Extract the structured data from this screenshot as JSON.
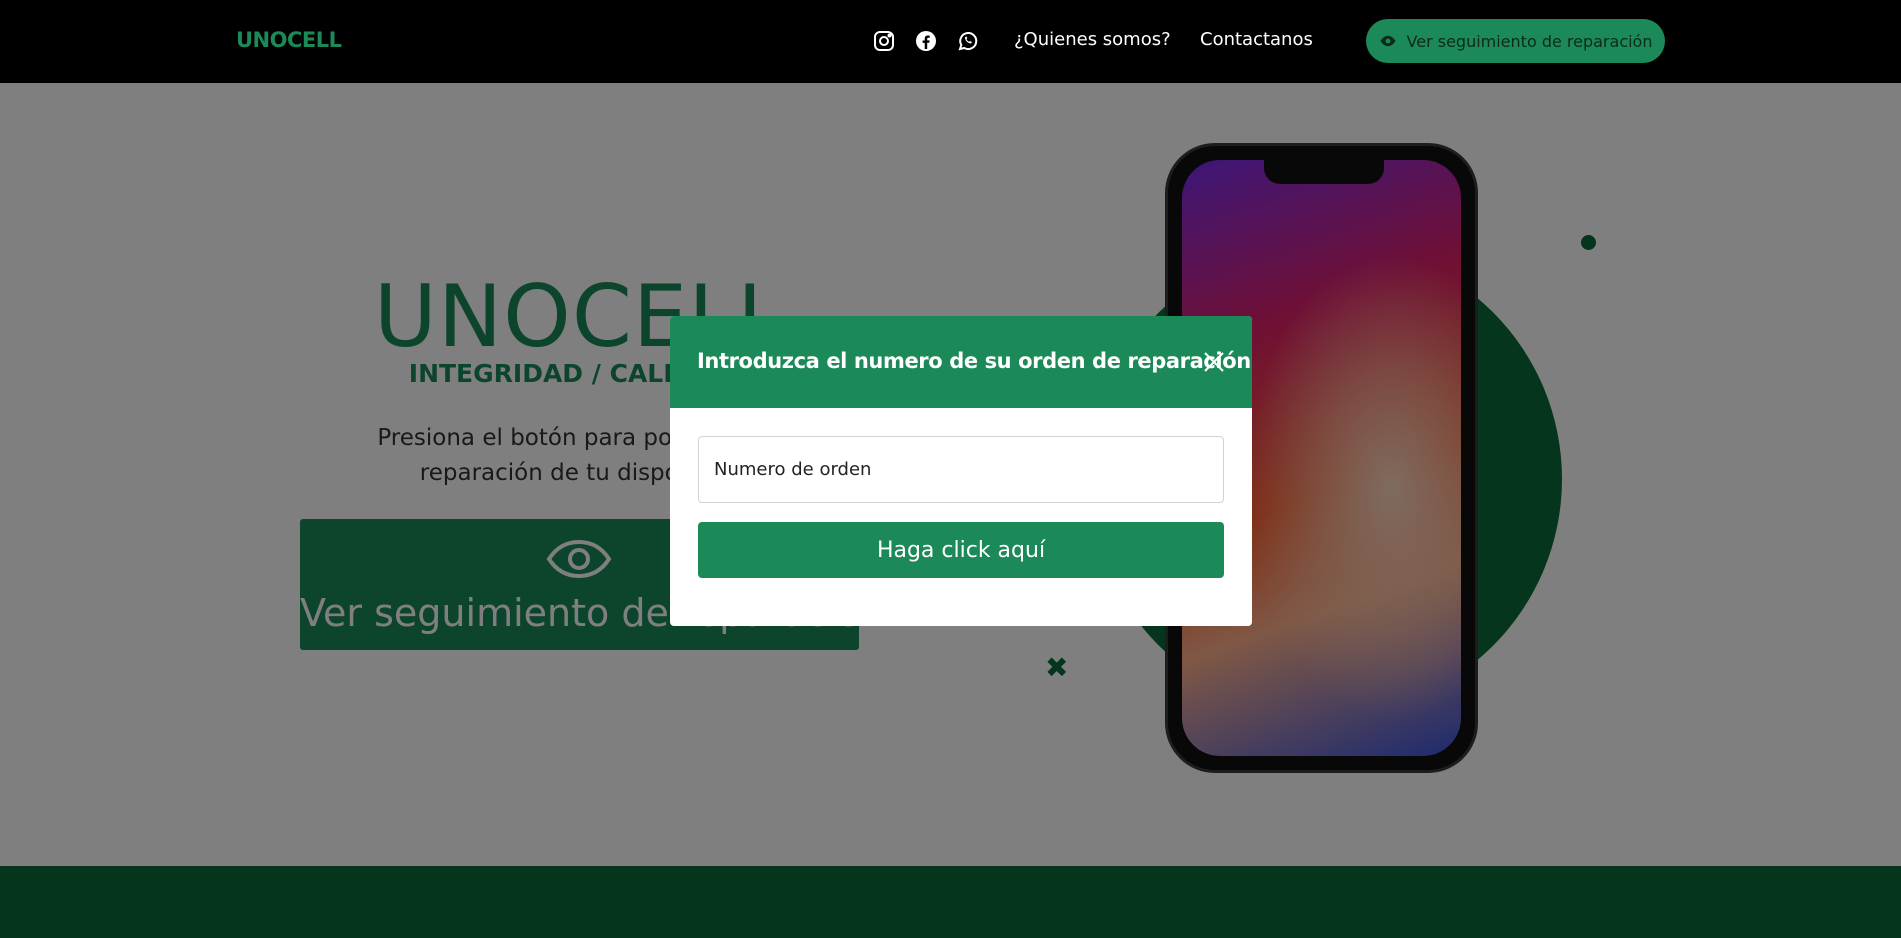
{
  "navbar": {
    "brand": "UNOCELL",
    "social_icons": [
      "instagram-icon",
      "facebook-icon",
      "whatsapp-icon"
    ],
    "links": [
      "¿Quienes somos?",
      "Contactanos"
    ],
    "track_button_label": "Ver seguimiento de reparación",
    "track_button_icon": "eye-icon"
  },
  "hero": {
    "title": "UNOCELL",
    "subtitle": "INTEGRIDAD / CALIDAD /",
    "description_line1": "Presiona el botón para poder ver el",
    "description_line2": "reparación de tu dispositivo",
    "button_label": "Ver seguimiento de reparación",
    "button_icon": "eye-icon"
  },
  "modal": {
    "title": "Introduzca el numero de su orden de reparación",
    "close_icon": "close-icon",
    "input_placeholder": "Numero de orden",
    "submit_label": "Haga click aquí"
  },
  "colors": {
    "brand_green": "#1b8a58",
    "dark_green": "#0a6b39",
    "navbar_bg": "#000000"
  }
}
